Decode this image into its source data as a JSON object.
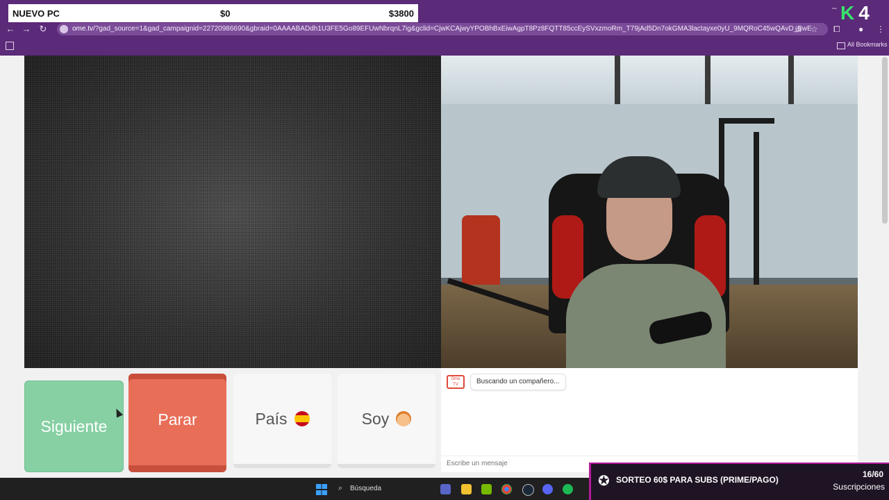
{
  "overlay": {
    "goal_title": "NUEVO PC",
    "goal_current": "$0",
    "goal_target": "$3800"
  },
  "browser": {
    "url_host": "ome.tv",
    "url_rest": "/?gad_source=1&gad_campaignid=22720986690&gbraid=0AAAABADdh1U3FE5Go89EFUwNbrqnL7ig&gclid=CjwKCAjwyYPOBhBxEiwAgpT8Pz8FQTT85ccEySVxzmoRm_T79jAd5Dn7okGMA3lactayxe0yU_9MQRoC45wQAvD_BwE",
    "bookmarks_label": "All Bookmarks",
    "icons": [
      "back-icon",
      "forward-icon",
      "reload-icon",
      "site-settings-icon",
      "install-icon",
      "star-icon",
      "extensions-icon",
      "profile-icon",
      "menu-icon",
      "apps-icon",
      "folder-icon"
    ]
  },
  "brand": {
    "k": "K",
    "num": "4"
  },
  "buttons": {
    "next": "Siguiente",
    "stop": "Parar",
    "country": "País",
    "gender": "Soy"
  },
  "chat": {
    "logo_text": "Ome TV",
    "status": "Buscando un compañero...",
    "input_placeholder": "Escribe un mensaje"
  },
  "promo": {
    "text": "SORTEO 60$ PARA SUBS (PRIME/PAGO)",
    "count": "16/60",
    "label": "Suscripciones"
  },
  "taskbar": {
    "search_label": "Búsqueda",
    "icons": [
      "windows-start-icon",
      "search-icon",
      "video-call-icon",
      "file-explorer-icon",
      "nvidia-icon",
      "chrome-icon",
      "steam-icon",
      "discord-icon",
      "spotify-icon"
    ]
  },
  "colors": {
    "chrome_purple": "#5b2a78",
    "next_green": "#86d0a3",
    "stop_red": "#e96e58",
    "promo_bg": "#1f1424",
    "promo_accent": "#b31b9a"
  }
}
